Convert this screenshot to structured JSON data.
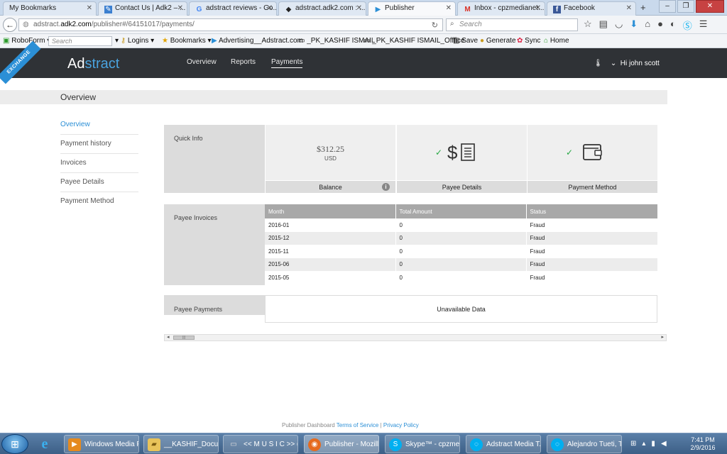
{
  "browser": {
    "tabs": [
      {
        "label": "My Bookmarks",
        "icon": "bookmarks-icon"
      },
      {
        "label": "Contact Us | Adk2 – ...",
        "icon": "page-icon"
      },
      {
        "label": "adstract reviews - Go...",
        "icon": "google-icon"
      },
      {
        "label": "adstract.adk2.com : ...",
        "icon": "site-icon"
      },
      {
        "label": "Publisher",
        "icon": "play-icon",
        "active": true
      },
      {
        "label": "Inbox - cpzmedianet...",
        "icon": "gmail-icon"
      },
      {
        "label": "Facebook",
        "icon": "facebook-icon"
      }
    ],
    "url_prefix": "adstract.",
    "url_domain": "adk2.com",
    "url_path": "/publisher#/64151017/payments/",
    "search_placeholder": "Search",
    "bookmarks": {
      "roboform": "RoboForm",
      "search_placeholder": "Search",
      "logins": "Logins",
      "bookmarks": "Bookmarks",
      "advertising": "Advertising__Adstract.com",
      "pk1": "_PK_KASHIF ISMAIL",
      "pk2": "_PK_KASHIF ISMAIL_Offfice",
      "save": "Save",
      "generate": "Generate",
      "sync": "Sync",
      "home": "Home"
    }
  },
  "app": {
    "logo_a": "Ad",
    "logo_b": "stract",
    "ribbon": "EXCHANGE",
    "nav": [
      "Overview",
      "Reports",
      "Payments"
    ],
    "active_nav": "Payments",
    "user": "Hi john scott"
  },
  "page": {
    "title": "Overview",
    "sidenav": [
      "Overview",
      "Payment history",
      "Invoices",
      "Payee Details",
      "Payment Method"
    ],
    "quick_info": {
      "label": "Quick Info",
      "balance_amount": "$312.25",
      "balance_currency": "USD",
      "balance_label": "Balance",
      "payee_details_label": "Payee Details",
      "payment_method_label": "Payment Method"
    },
    "invoices": {
      "label": "Payee Invoices",
      "headers": [
        "Month",
        "Total Amount",
        "Status"
      ],
      "rows": [
        [
          "2016-01",
          "0",
          "Fraud"
        ],
        [
          "2015-12",
          "0",
          "Fraud"
        ],
        [
          "2015-11",
          "0",
          "Fraud"
        ],
        [
          "2015-06",
          "0",
          "Fraud"
        ],
        [
          "2015-05",
          "0",
          "Fraud"
        ]
      ]
    },
    "payments": {
      "label": "Payee Payments",
      "empty_text": "Unavailable Data"
    },
    "footer": {
      "prefix": "Publisher Dashboard",
      "terms": "Terms of Service",
      "sep": "|",
      "privacy": "Privacy Policy"
    }
  },
  "taskbar": {
    "items": [
      {
        "label": "Windows Media P...",
        "icon": "media-player-icon"
      },
      {
        "label": "__KASHIF_Docum...",
        "icon": "folder-icon"
      },
      {
        "label": "<< M U S I C >> (...",
        "icon": "drive-icon"
      },
      {
        "label": "Publisher - Mozill...",
        "icon": "firefox-icon"
      },
      {
        "label": "Skype™ - cpzmedia",
        "icon": "skype-icon"
      },
      {
        "label": "Adstract Media T...",
        "icon": "chat-icon"
      },
      {
        "label": "Alejandro Tueti, T...",
        "icon": "chat-icon"
      }
    ],
    "time": "7:41 PM",
    "date": "2/9/2016"
  }
}
